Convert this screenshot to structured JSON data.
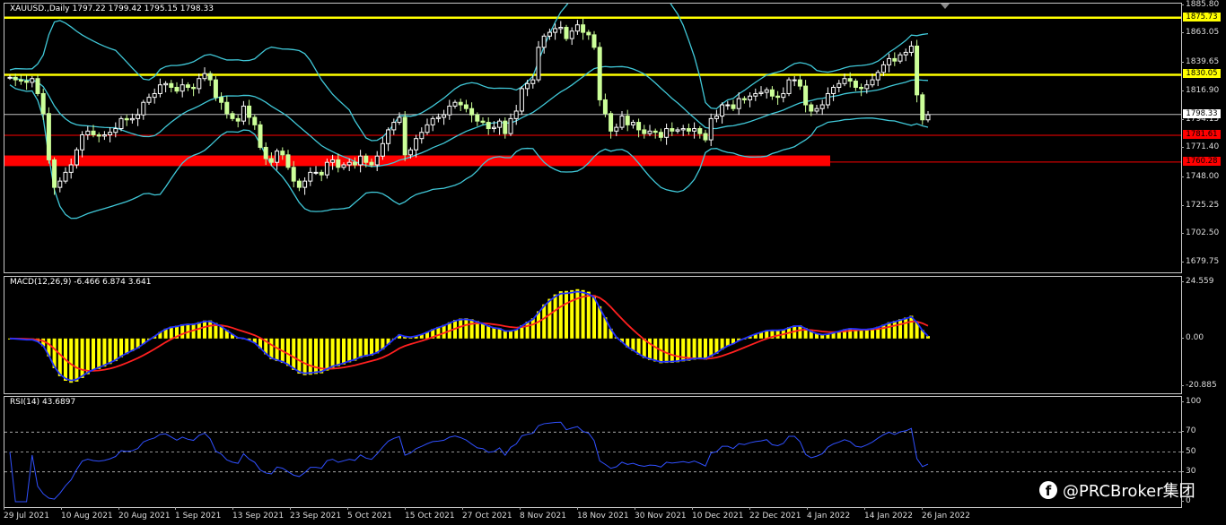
{
  "main": {
    "title": "XAUUSD.,Daily  1797.22 1799.42 1795.15 1798.33",
    "yrange": [
      1672,
      1887
    ],
    "y_ticks": [
      "1885.80",
      "1863.05",
      "1839.65",
      "1816.90",
      "1794.15",
      "1771.40",
      "1748.00",
      "1725.25",
      "1702.50",
      "1679.75"
    ],
    "y_tick_values": [
      1885.8,
      1863.05,
      1839.65,
      1816.9,
      1794.15,
      1771.4,
      1748.0,
      1725.25,
      1702.5,
      1679.75
    ],
    "levels": [
      {
        "label": "1875.73",
        "value": 1875.73,
        "color": "#ffff00",
        "bg": "#ffff00",
        "fg": "#000000"
      },
      {
        "label": "1830.05",
        "value": 1830.05,
        "color": "#ffff00",
        "bg": "#ffff00",
        "fg": "#000000"
      },
      {
        "label": "1798.33",
        "value": 1798.33,
        "color": "#c0c0c0",
        "bg": "#ffffff",
        "fg": "#000000"
      },
      {
        "label": "1781.61",
        "value": 1781.61,
        "color": "#ff0000",
        "bg": "#ff0000",
        "fg": "#000000"
      },
      {
        "label": "1760.28",
        "value": 1760.28,
        "color": "#ff0000",
        "bg": "#ff0000",
        "fg": "#000000"
      }
    ],
    "red_zone": {
      "from": 1757.0,
      "to": 1765.5,
      "color": "#ff0000"
    },
    "candle_up_color": "#ffffff",
    "candle_down_color": "#ccff99",
    "band_color": "#40c8d8"
  },
  "macd": {
    "title": "MACD(12,26,9) -6.466 6.874 3.641",
    "yrange": [
      -24,
      27
    ],
    "y_ticks": [
      "24.559",
      "0.00",
      "-20.885"
    ],
    "y_tick_values": [
      24.559,
      0.0,
      -20.885
    ],
    "hist_color": "#ffff00",
    "signal_color": "#ff2020",
    "macd_color": "#2030ff"
  },
  "rsi": {
    "title": "RSI(14) 43.6897",
    "yrange": [
      0,
      100
    ],
    "y_ticks": [
      "100",
      "70",
      "50",
      "30",
      "0"
    ],
    "y_tick_values": [
      100,
      70,
      50,
      30,
      0
    ],
    "dashed_levels": [
      70,
      50,
      30
    ],
    "line_color": "#3050ff"
  },
  "x_labels": [
    "29 Jul 2021",
    "10 Aug 2021",
    "20 Aug 2021",
    "1 Sep 2021",
    "13 Sep 2021",
    "23 Sep 2021",
    "5 Oct 2021",
    "15 Oct 2021",
    "27 Oct 2021",
    "8 Nov 2021",
    "18 Nov 2021",
    "30 Nov 2021",
    "10 Dec 2021",
    "22 Dec 2021",
    "4 Jan 2022",
    "14 Jan 2022",
    "26 Jan 2022"
  ],
  "chart_data": {
    "type": "candlestick",
    "title": "XAUUSD.,Daily",
    "symbol": "XAUUSD.",
    "timeframe": "Daily",
    "last_bar": {
      "open": 1797.22,
      "high": 1799.42,
      "low": 1795.15,
      "close": 1798.33
    },
    "indicators": [
      "Bollinger Bands",
      "MACD(12,26,9)",
      "RSI(14)"
    ],
    "macd_values": {
      "macd": -6.466,
      "signal": 6.874,
      "histogram": 3.641
    },
    "rsi_value": 43.6897,
    "close_series": [
      1828,
      1826,
      1825,
      1824,
      1827,
      1815,
      1799,
      1762,
      1740,
      1745,
      1752,
      1758,
      1770,
      1782,
      1785,
      1782,
      1781,
      1782,
      1784,
      1787,
      1795,
      1794,
      1795,
      1798,
      1808,
      1812,
      1815,
      1822,
      1823,
      1820,
      1817,
      1822,
      1820,
      1819,
      1827,
      1831,
      1826,
      1812,
      1808,
      1799,
      1795,
      1793,
      1805,
      1796,
      1790,
      1772,
      1763,
      1760,
      1769,
      1766,
      1756,
      1745,
      1740,
      1745,
      1752,
      1752,
      1750,
      1760,
      1762,
      1756,
      1758,
      1760,
      1758,
      1765,
      1760,
      1758,
      1765,
      1775,
      1786,
      1792,
      1796,
      1766,
      1770,
      1779,
      1784,
      1790,
      1795,
      1796,
      1798,
      1805,
      1808,
      1806,
      1803,
      1798,
      1793,
      1792,
      1787,
      1788,
      1793,
      1783,
      1795,
      1801,
      1819,
      1823,
      1826,
      1852,
      1861,
      1864,
      1867,
      1868,
      1859,
      1865,
      1870,
      1864,
      1862,
      1852,
      1810,
      1799,
      1785,
      1788,
      1797,
      1790,
      1792,
      1786,
      1783,
      1785,
      1784,
      1780,
      1787,
      1785,
      1786,
      1787,
      1785,
      1787,
      1783,
      1778,
      1795,
      1797,
      1806,
      1806,
      1803,
      1811,
      1810,
      1813,
      1815,
      1816,
      1818,
      1813,
      1812,
      1815,
      1826,
      1826,
      1821,
      1806,
      1801,
      1803,
      1806,
      1815,
      1820,
      1823,
      1827,
      1825,
      1820,
      1819,
      1822,
      1826,
      1832,
      1838,
      1843,
      1841,
      1846,
      1848,
      1853,
      1814,
      1794,
      1798
    ]
  }
}
